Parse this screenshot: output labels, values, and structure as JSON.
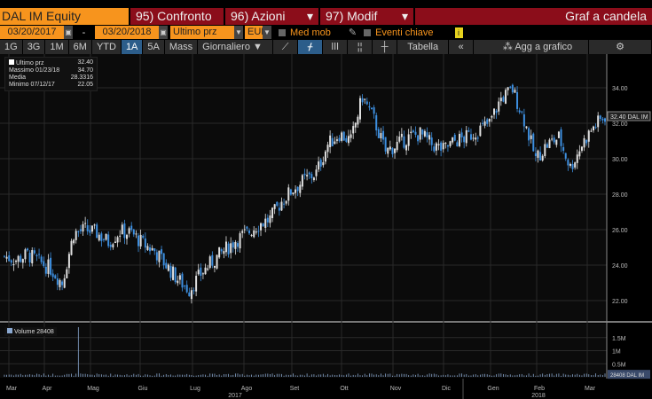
{
  "header": {
    "ticker": "DAL IM Equity",
    "compare": "95) Confronto",
    "actions": "96) Azioni",
    "modify": "97) Modif",
    "chart_type": "Graf a candela"
  },
  "controls": {
    "start_date": "03/20/2017",
    "dash": "-",
    "end_date": "03/20/2018",
    "field": "Ultimo prz",
    "currency": "EUR",
    "moving_avg": "Med mob",
    "key_events": "Eventi chiave",
    "info": "i"
  },
  "toolbar": {
    "periods": [
      "1G",
      "3G",
      "1M",
      "6M",
      "YTD",
      "1A",
      "5A",
      "Mass"
    ],
    "active_period": "1A",
    "frequency": "Giornaliero ▼",
    "table": "Tabella",
    "collapse": "«",
    "add_to_chart": "Agg a grafico",
    "settings": "⚙"
  },
  "legend": {
    "last": {
      "label": "Ultimo prz",
      "value": "32.40"
    },
    "max": {
      "label": "Massimo 01/23/18",
      "value": "34.70"
    },
    "avg": {
      "label": "Media",
      "value": "28.3316"
    },
    "min": {
      "label": "Minimo 07/12/17",
      "value": "22.05"
    }
  },
  "volume_legend": "Volume 28408",
  "last_price_tag": "32.40 DAL IM",
  "last_volume_tag": "28408 DAL IM",
  "colors": {
    "up": "#e0e0e0",
    "down": "#3d8fe0",
    "accent": "#f7941d",
    "header_red": "#8b0d1a"
  },
  "chart_data": {
    "type": "candlestick",
    "title": "DAL IM Equity",
    "x_start": "2017-03-20",
    "x_end": "2018-03-20",
    "weekly_close": [
      24.5,
      24.3,
      24.6,
      24.2,
      23.8,
      23.0,
      25.8,
      26.0,
      25.8,
      25.3,
      25.9,
      25.8,
      25.2,
      24.8,
      24.0,
      23.2,
      22.6,
      23.5,
      24.2,
      24.8,
      25.4,
      25.8,
      26.3,
      26.6,
      27.6,
      28.3,
      28.8,
      29.2,
      30.8,
      31.4,
      31.0,
      33.5,
      32.2,
      30.4,
      30.8,
      31.2,
      31.4,
      30.8,
      30.5,
      31.0,
      31.2,
      31.6,
      32.0,
      33.4,
      33.9,
      32.2,
      30.0,
      30.8,
      31.2,
      29.5,
      30.8,
      31.8,
      32.4
    ],
    "price_ticks": [
      "22.00",
      "24.00",
      "26.00",
      "28.00",
      "30.00",
      "32.00",
      "34.00"
    ],
    "ylim": [
      20.85,
      35.85
    ],
    "volume_ticks": [
      "0.5M",
      "1M",
      "1.5M"
    ],
    "volume_ylim": [
      0,
      2000000
    ],
    "volume_spike": {
      "date": "2017-05-03",
      "value": 1900000
    },
    "month_labels": [
      "Mar",
      "Apr",
      "Mag",
      "Giu",
      "Lug",
      "Ago",
      "Set",
      "Ott",
      "Nov",
      "Dic",
      "Gen",
      "Feb",
      "Mar"
    ],
    "year_labels": [
      "2017",
      "2018"
    ]
  }
}
